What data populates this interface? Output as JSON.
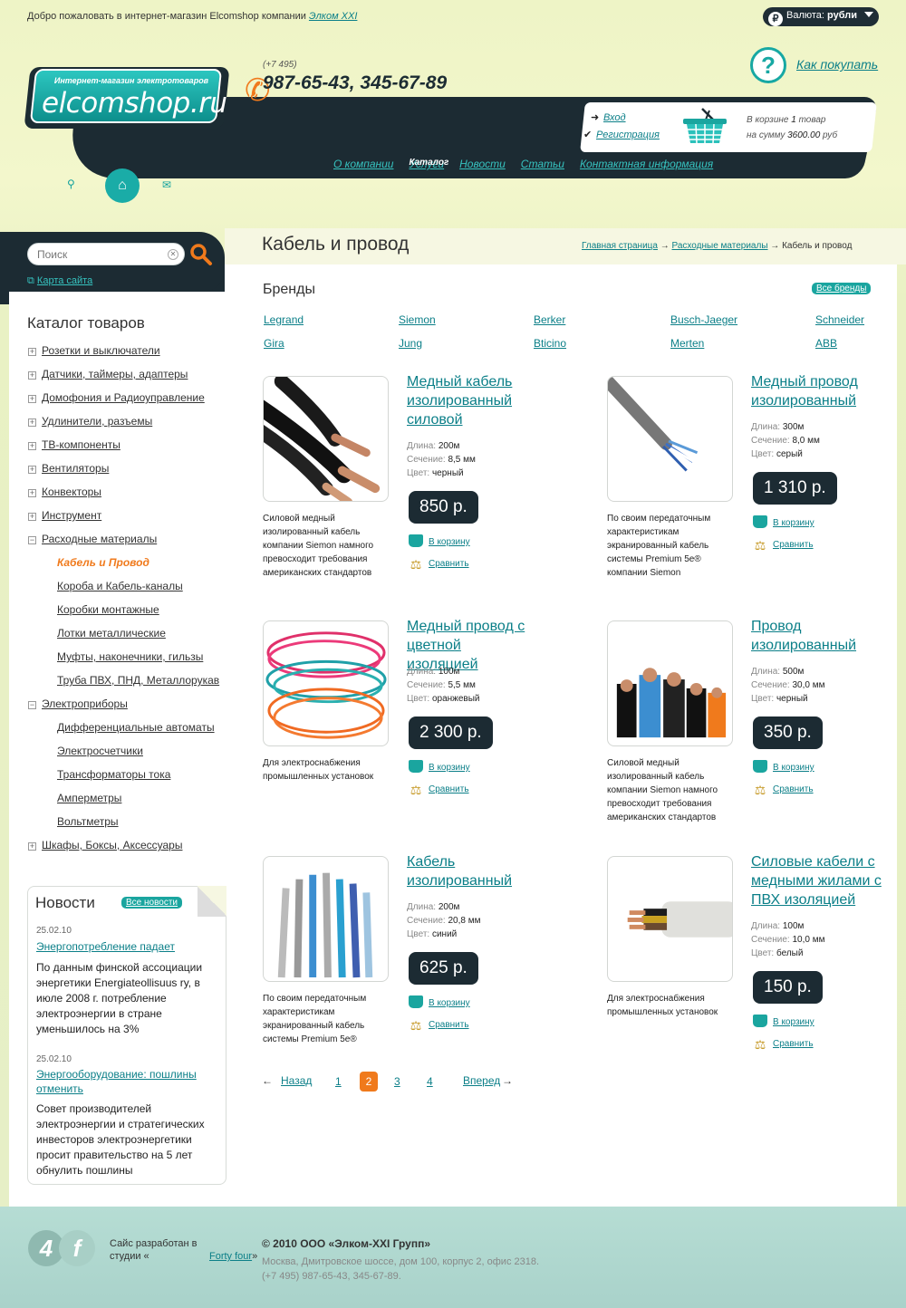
{
  "welcome": {
    "text": "Добро пожаловать в интернет-магазин Elcomshop компании ",
    "company": "Элком XXI"
  },
  "currency": {
    "label": "Валюта:",
    "value": "рубли",
    "symbol": "₽"
  },
  "howto": {
    "label": "Как покупать",
    "icon": "?"
  },
  "logo": {
    "tagline": "Интернет-магазин электротоваров",
    "name": "elcomshop.ru"
  },
  "phone": {
    "code": "(+7 495)",
    "numbers": "987-65-43, 345-67-89"
  },
  "auth": {
    "login": "Вход",
    "register": "Регистрация"
  },
  "cart": {
    "line1_prefix": "В корзине ",
    "count": "1",
    "line1_suffix": " товар",
    "line2_prefix": "на сумму ",
    "sum": "3600.00",
    "line2_suffix": " руб"
  },
  "nav": [
    {
      "label": "О компании"
    },
    {
      "label": "Каталог",
      "active": true
    },
    {
      "label": "Услуги"
    },
    {
      "label": "Новости"
    },
    {
      "label": "Статьи"
    },
    {
      "label": "Контактная информация"
    }
  ],
  "search": {
    "placeholder": "Поиск"
  },
  "sitemap": {
    "label": "Карта сайта"
  },
  "catalog": {
    "title": "Каталог товаров",
    "items": [
      {
        "label": "Розетки и выключатели",
        "sign": "+"
      },
      {
        "label": "Датчики, таймеры, адаптеры",
        "sign": "+"
      },
      {
        "label": "Домофония и Радиоуправление",
        "sign": "+"
      },
      {
        "label": "Удлинители, разъемы",
        "sign": "+"
      },
      {
        "label": "ТВ-компоненты",
        "sign": "+"
      },
      {
        "label": "Вентиляторы",
        "sign": "+"
      },
      {
        "label": "Конвекторы",
        "sign": "+"
      },
      {
        "label": "Инструмент",
        "sign": "+"
      },
      {
        "label": "Расходные материалы",
        "sign": "−"
      },
      {
        "label": "Кабель и Провод",
        "sub": true,
        "active": true
      },
      {
        "label": "Короба и Кабель-каналы",
        "sub": true
      },
      {
        "label": "Коробки монтажные",
        "sub": true
      },
      {
        "label": "Лотки металлические",
        "sub": true
      },
      {
        "label": "Муфты, наконечники, гильзы",
        "sub": true
      },
      {
        "label": "Труба ПВХ, ПНД, Металлорукав",
        "sub": true
      },
      {
        "label": "Электроприборы",
        "sign": "−"
      },
      {
        "label": "Дифференциальные автоматы",
        "sub": true
      },
      {
        "label": "Электросчетчики",
        "sub": true
      },
      {
        "label": "Трансформаторы тока",
        "sub": true
      },
      {
        "label": "Амперметры",
        "sub": true
      },
      {
        "label": "Вольтметры",
        "sub": true
      },
      {
        "label": "Шкафы, Боксы, Аксессуары",
        "sign": "+"
      }
    ]
  },
  "news": {
    "title": "Новости",
    "all": "Все новости",
    "items": [
      {
        "date": "25.02.10",
        "title": "Энергопотребление падает",
        "text": "По данным финской ассоциации энергетики Energiateollisuus ry, в июле 2008 г. потребление электроэнергии в стране уменьшилось на 3%"
      },
      {
        "date": "25.02.10",
        "title": "Энергооборудование: пошлины отменить",
        "text": "Совет производителей электроэнергии и стратегических инвесторов электроэнергетики просит правительство на 5 лет обнулить пошлины"
      }
    ]
  },
  "page": {
    "title": "Кабель и провод",
    "breadcrumb": [
      "Главная страница",
      "Расходные материалы",
      "Кабель и провод"
    ],
    "sep": " → "
  },
  "brands": {
    "title": "Бренды",
    "all": "Все бренды",
    "items": [
      "Legrand",
      "Siemon",
      "Berker",
      "Busch-Jaeger",
      "Schneider",
      "Gira",
      "Jung",
      "Bticino",
      "Merten",
      "ABB"
    ]
  },
  "labels": {
    "length": "Длина: ",
    "section": "Сечение: ",
    "color": "Цвет: ",
    "to_cart": "В корзину",
    "compare": "Сравнить"
  },
  "products": [
    {
      "title": "Медный кабель изолированный силовой",
      "length": "200м",
      "section": "8,5 мм",
      "color": "черный",
      "price": "850 р.",
      "desc": "Силовой медный изолированный кабель компании Siemon намного превосходит требования американских стандартов"
    },
    {
      "title": "Медный провод изолированный",
      "length": "300м",
      "section": "8,0 мм",
      "color": "серый",
      "price": "1 310 р.",
      "desc": "По своим передаточным характеристикам экранированный кабель системы Premium 5e® компании Siemon"
    },
    {
      "title": "Медный провод с цветной изоляцией",
      "length": "100м",
      "section": "5,5 мм",
      "color": "оранжевый",
      "price": "2 300 р.",
      "desc": "Для электроснабжения промышленных установок"
    },
    {
      "title": "Провод изолированный",
      "length": "500м",
      "section": "30,0 мм",
      "color": "черный",
      "price": "350 р.",
      "desc": "Силовой медный изолированный кабель компании Siemon намного превосходит требования американских стандартов"
    },
    {
      "title": "Кабель изолированный",
      "length": "200м",
      "section": "20,8 мм",
      "color": "синий",
      "price": "625 р.",
      "desc": "По своим передаточным характеристикам экранированный кабель системы Premium 5e®"
    },
    {
      "title": "Силовые кабели с медными жилами с ПВХ изоляцией",
      "length": "100м",
      "section": "10,0 мм",
      "color": "белый",
      "price": "150 р.",
      "desc": "Для электроснабжения промышленных установок"
    }
  ],
  "pager": {
    "prev": "Назад",
    "next": "Вперед",
    "prev_arrow": "←",
    "next_arrow": "→",
    "pages": [
      "1",
      "2",
      "3",
      "4"
    ],
    "current": "2"
  },
  "footer": {
    "logo": [
      "4",
      "f"
    ],
    "dev_prefix": "Сайс разработан в студии «",
    "dev_link": "Forty four",
    "dev_suffix": "»",
    "copy": "© 2010 ООО «Элком-XXI Групп»",
    "address": "Москва, Дмитровское шоссе, дом 100, корпус 2, офис 2318.",
    "phone": "(+7 495) 987-65-43, 345-67-89."
  },
  "colors": {
    "accent": "#1aa59f",
    "dark": "#1c2b33",
    "orange": "#f07a1c",
    "link": "#0b7f88"
  }
}
